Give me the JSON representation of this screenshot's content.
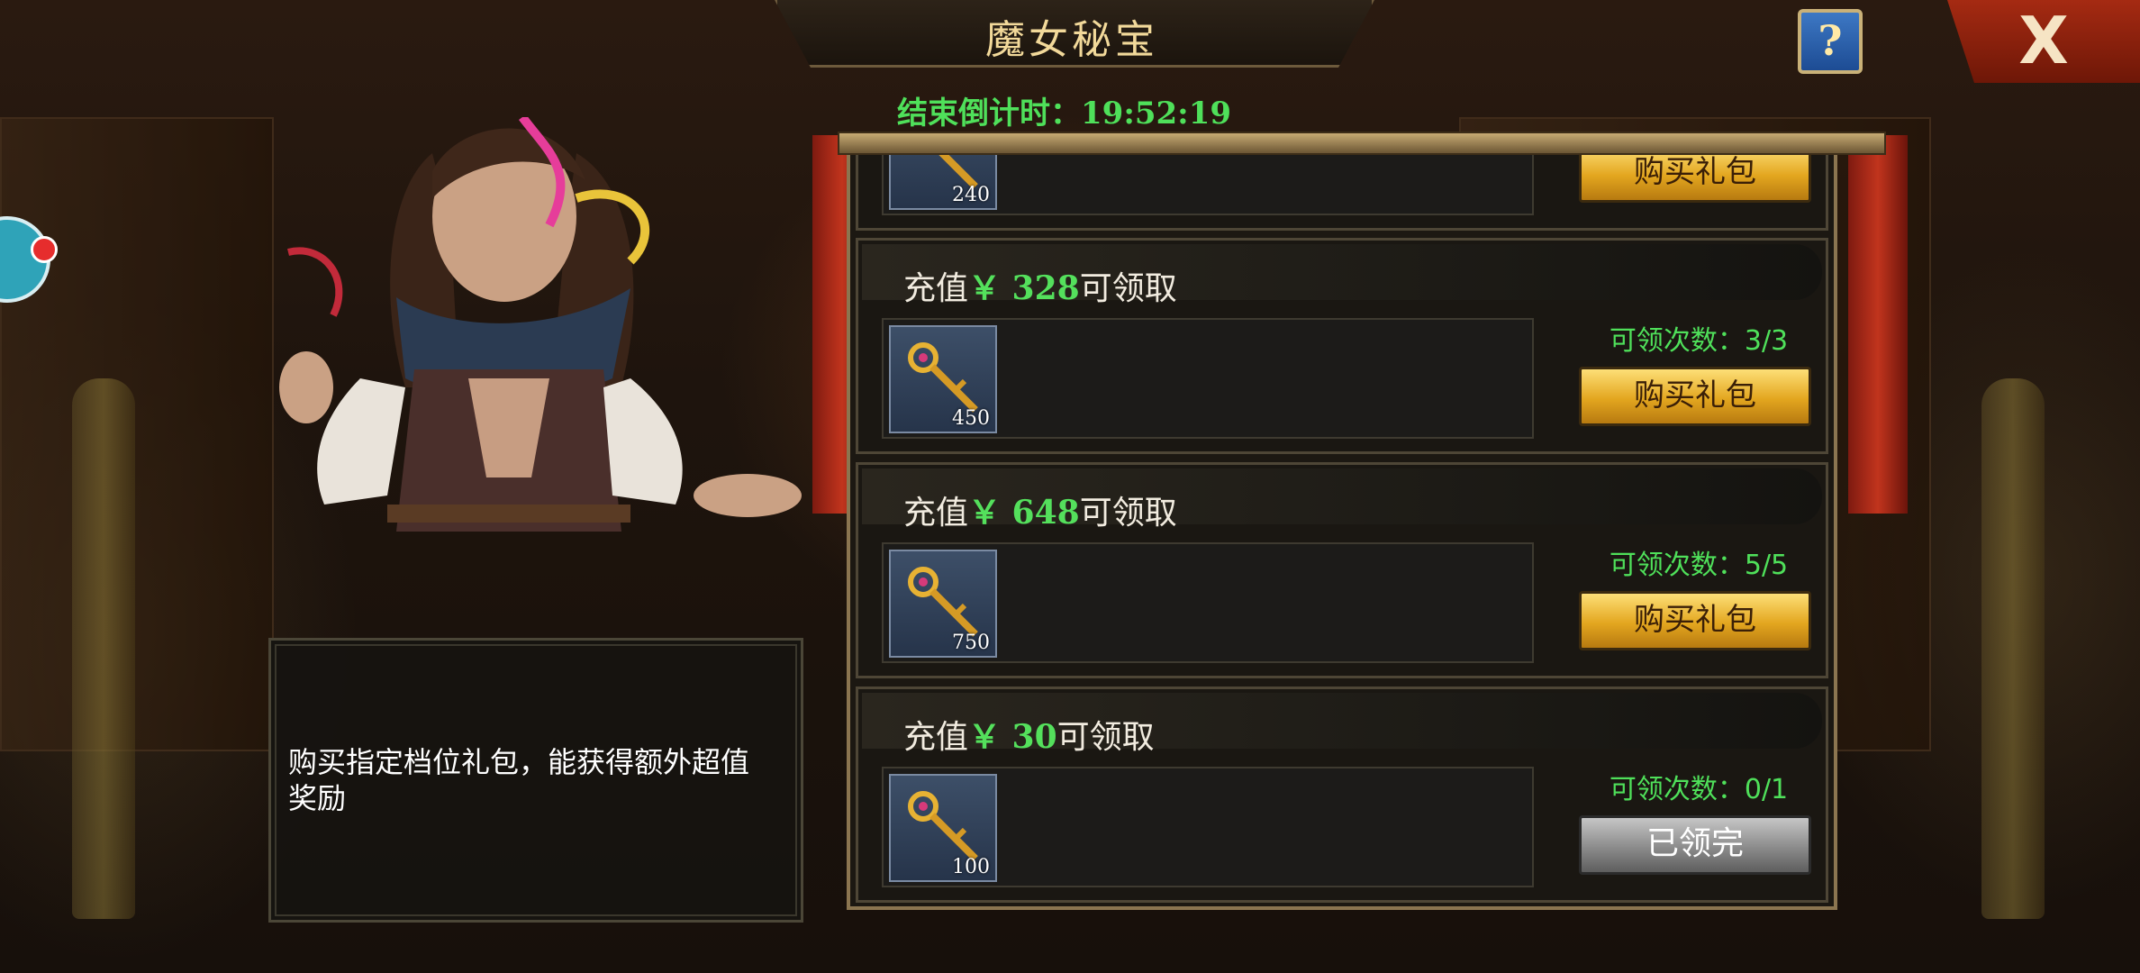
{
  "header": {
    "title": "魔女秘宝",
    "help_label": "?",
    "close_label": "X",
    "countdown_label": "结束倒计时：",
    "countdown_value": "19:52:19"
  },
  "description": "购买指定档位礼包，能获得额外超值奖励",
  "partial_card": {
    "item_count": "240",
    "button_label": "购买礼包"
  },
  "packages": [
    {
      "title_prefix": "充值",
      "currency": "￥ 328",
      "title_suffix": "可领取",
      "item_count": "450",
      "claim_label": "可领次数：3/3",
      "button_label": "购买礼包",
      "button_state": "buy"
    },
    {
      "title_prefix": "充值",
      "currency": "￥ 648",
      "title_suffix": "可领取",
      "item_count": "750",
      "claim_label": "可领次数：5/5",
      "button_label": "购买礼包",
      "button_state": "buy"
    },
    {
      "title_prefix": "充值",
      "currency": "￥ 30",
      "title_suffix": "可领取",
      "item_count": "100",
      "claim_label": "可领次数：0/1",
      "button_label": "已领完",
      "button_state": "done"
    }
  ],
  "colors": {
    "accent_green": "#4fe05a",
    "gold": "#f2d99a",
    "close_red": "#a52a12"
  },
  "icons": {
    "item": "golden-key-icon",
    "help": "question-mark-icon",
    "close": "close-icon"
  }
}
